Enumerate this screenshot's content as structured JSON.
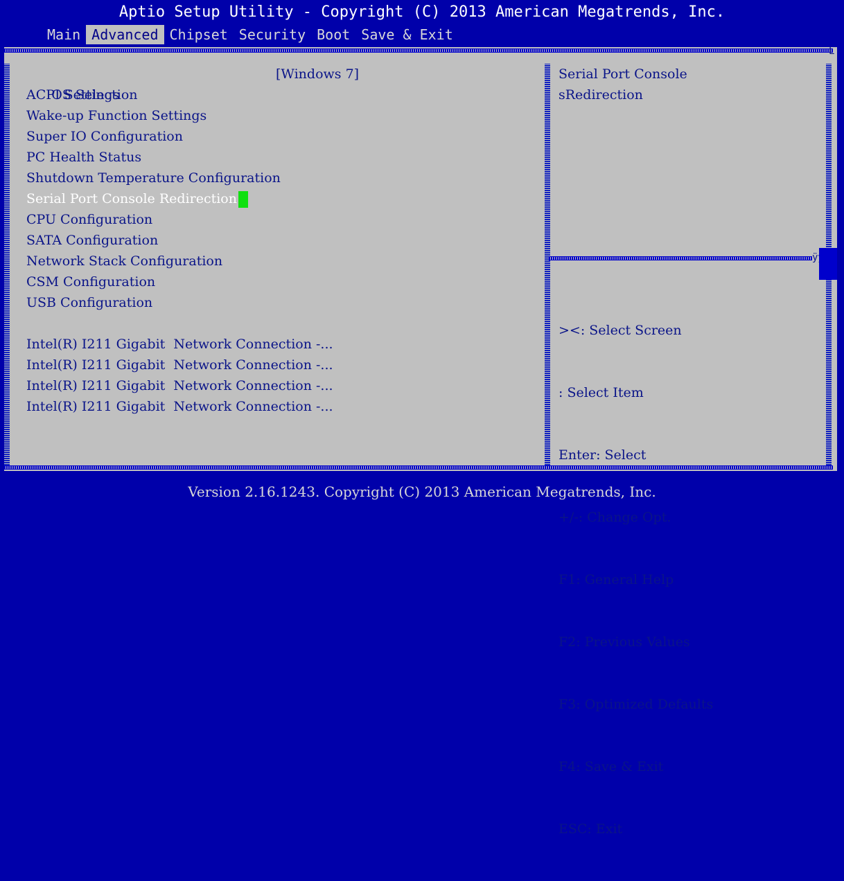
{
  "header": {
    "title": "Aptio Setup Utility - Copyright (C) 2013 American Megatrends, Inc."
  },
  "tabs": [
    {
      "label": "Main",
      "active": false
    },
    {
      "label": "Advanced",
      "active": true
    },
    {
      "label": "Chipset",
      "active": false
    },
    {
      "label": "Security",
      "active": false
    },
    {
      "label": "Boot",
      "active": false
    },
    {
      "label": "Save & Exit",
      "active": false
    }
  ],
  "menu": {
    "os_selection": {
      "label": "OS Selection",
      "value": "[Windows 7]"
    },
    "items": [
      {
        "label": "ACPI Settings"
      },
      {
        "label": "Wake-up Function Settings"
      },
      {
        "label": "Super IO Configuration"
      },
      {
        "label": "PC Health Status"
      },
      {
        "label": "Shutdown Temperature Configuration"
      },
      {
        "label": "Serial Port Console Redirection",
        "selected": true
      },
      {
        "label": "CPU Configuration"
      },
      {
        "label": "SATA Configuration"
      },
      {
        "label": "Network Stack Configuration"
      },
      {
        "label": "CSM Configuration"
      },
      {
        "label": "USB Configuration"
      }
    ],
    "nics": [
      {
        "label": "Intel(R) I211 Gigabit  Network Connection -..."
      },
      {
        "label": "Intel(R) I211 Gigabit  Network Connection -..."
      },
      {
        "label": "Intel(R) I211 Gigabit  Network Connection -..."
      },
      {
        "label": "Intel(R) I211 Gigabit  Network Connection -..."
      }
    ]
  },
  "help": {
    "line1": "Serial Port Console",
    "line2": "sRedirection"
  },
  "keys": [
    "><: Select Screen",
    ": Select Item",
    "Enter: Select",
    "+/-: Change Opt.",
    "F1: General Help",
    "F2: Previous Values",
    "F3: Optimized Defaults",
    "F4: Save & Exit",
    "ESC: Exit"
  ],
  "glyphs": {
    "top_right": "L",
    "mid_right": "ÿÿ"
  },
  "footer": {
    "text": "Version 2.16.1243. Copyright (C) 2013 American Megatrends, Inc."
  },
  "colors": {
    "background": "#0000aa",
    "panel": "#c0c0c0",
    "text": "#0a1488",
    "cursor": "#10e010"
  }
}
